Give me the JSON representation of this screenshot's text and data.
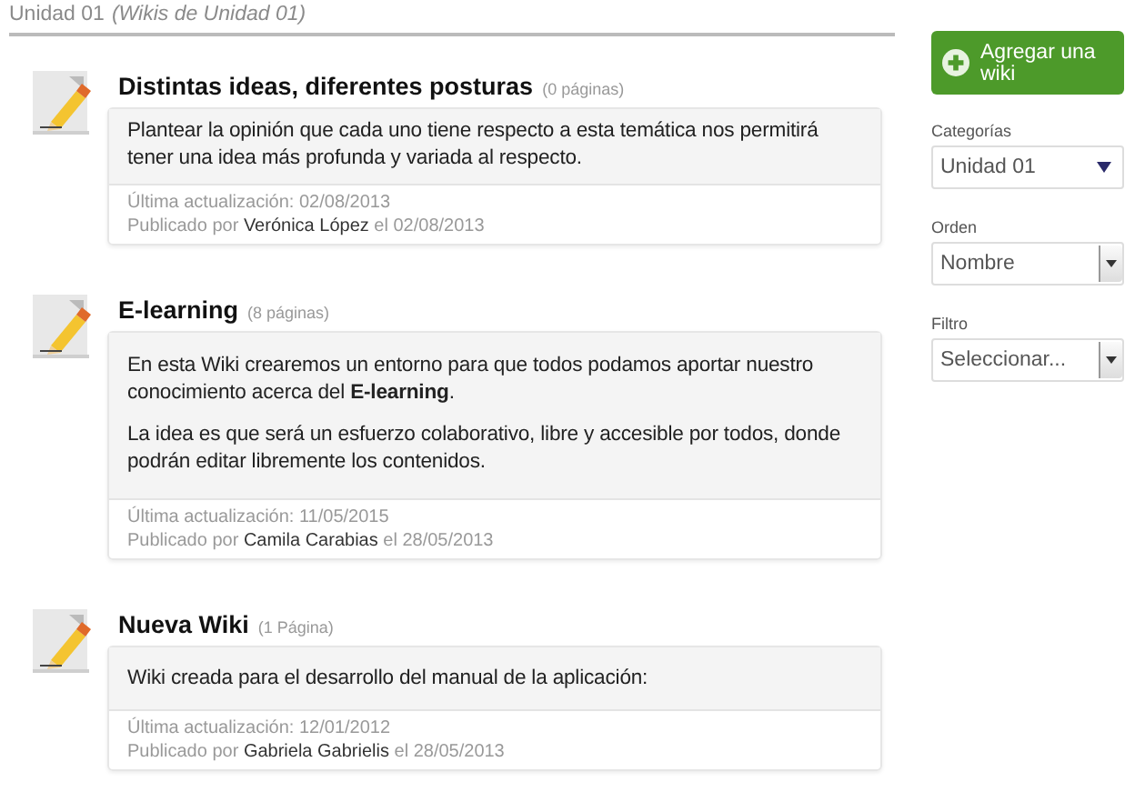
{
  "header": {
    "title": "Unidad 01",
    "subtitle": "(Wikis de Unidad 01)"
  },
  "wikis": [
    {
      "title": "Distintas ideas, diferentes posturas",
      "pages": "(0 páginas)",
      "paragraphs": [
        "Plantear la opinión que cada uno tiene respecto a esta temática nos permitirá tener una idea más profunda y variada al respecto."
      ],
      "updated": "Última actualización: 02/08/2013",
      "published": "Publicado por **Verónica López** el 02/08/2013"
    },
    {
      "title": "E-learning",
      "pages": "(8 páginas)",
      "paragraphs": [
        "En esta Wiki crearemos un entorno para que todos podamos aportar nuestro conocimiento acerca del **E-learning**.",
        "La idea es que será un esfuerzo colaborativo, libre y accesible por todos, donde podrán editar libremente los contenidos."
      ],
      "updated": "Última actualización: 11/05/2015",
      "published": "Publicado por **Camila Carabias** el 28/05/2013"
    },
    {
      "title": "Nueva Wiki",
      "pages": "(1 Página)",
      "paragraphs": [
        "Wiki creada para el desarrollo del manual de la aplicación:"
      ],
      "updated": "Última actualización: 12/01/2012",
      "published": "Publicado por **Gabriela Gabrielis** el 28/05/2013"
    }
  ],
  "sidebar": {
    "add_button": "Agregar una wiki",
    "filters": [
      {
        "label": "Categorías",
        "value": "Unidad 01",
        "kind": "plain"
      },
      {
        "label": "Orden",
        "value": "Nombre",
        "kind": "boxed"
      },
      {
        "label": "Filtro",
        "value": "Seleccionar...",
        "kind": "boxed"
      }
    ]
  }
}
